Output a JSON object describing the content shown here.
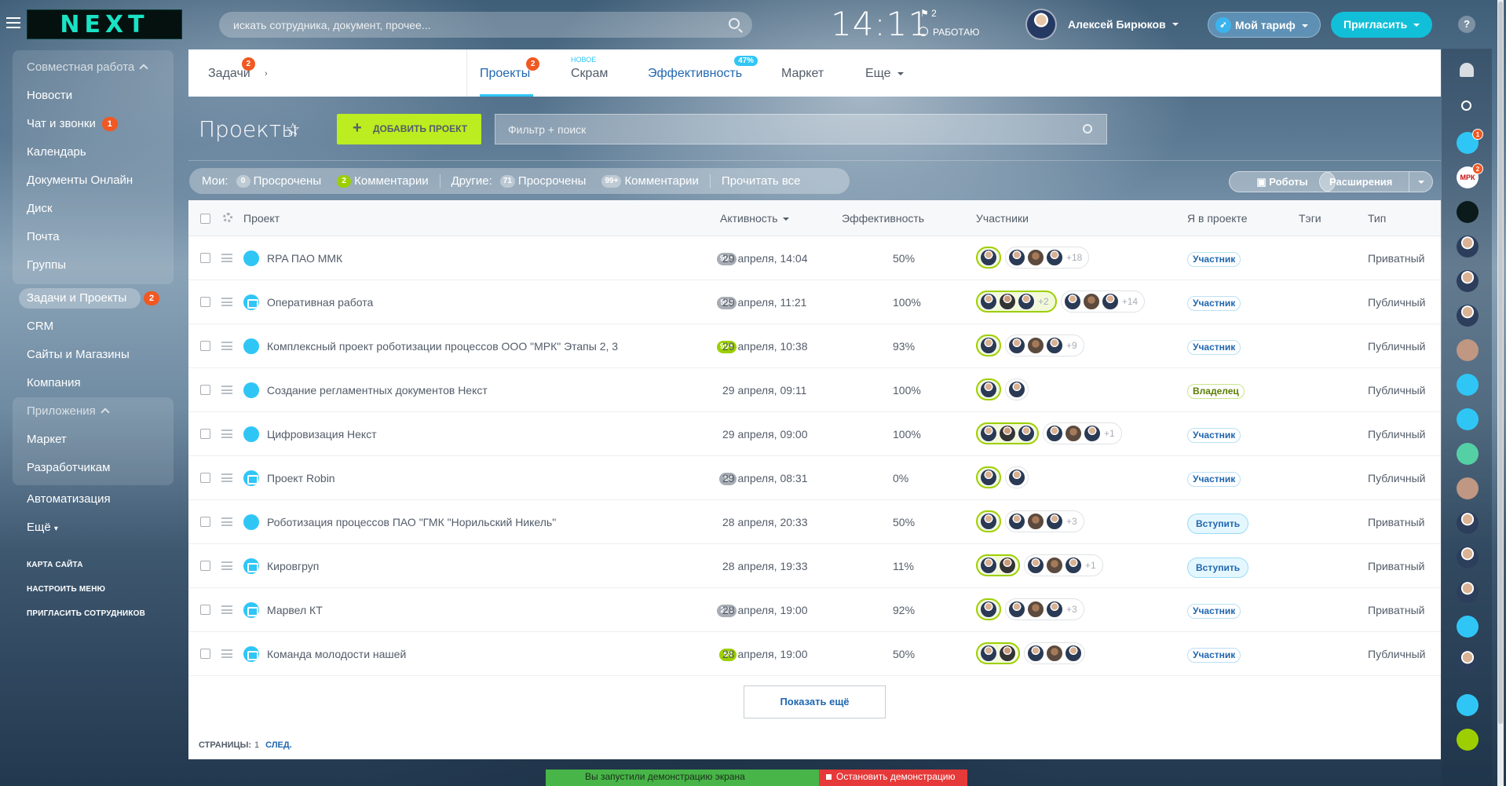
{
  "header": {
    "logo": "NEXT",
    "search_placeholder": "искать сотрудника, документ, прочее...",
    "clock": "14:11",
    "flag_count": "2",
    "work_status": "РАБОТАЮ",
    "user_name": "Алексей Бирюков",
    "tariff_label": "Мой тариф",
    "invite_label": "Пригласить",
    "help": "?"
  },
  "sidebar": {
    "group1_title": "Совместная работа",
    "group1_items": [
      "Новости",
      "Чат и звонки",
      "Календарь",
      "Документы Онлайн",
      "Диск",
      "Почта",
      "Группы"
    ],
    "chat_badge": "1",
    "active_item": "Задачи и Проекты",
    "active_badge": "2",
    "items2": [
      "CRM",
      "Сайты и Магазины",
      "Компания"
    ],
    "group2_title": "Приложения",
    "group2_items": [
      "Маркет",
      "Разработчикам"
    ],
    "items3": [
      "Автоматизация",
      "Ещё"
    ],
    "small_links": [
      "КАРТА САЙТА",
      "НАСТРОИТЬ МЕНЮ",
      "ПРИГЛАСИТЬ СОТРУДНИКОВ"
    ]
  },
  "tabs": {
    "tasks": "Задачи",
    "tasks_count": "2",
    "projects": "Проекты",
    "projects_count": "2",
    "scrum": "Скрам",
    "scrum_new": "НОВОЕ",
    "efficiency": "Эффективность",
    "efficiency_pct": "47%",
    "market": "Маркет",
    "more": "Еще"
  },
  "toolbar": {
    "title": "Проекты",
    "add_button": "Добавить проект",
    "filter_placeholder": "Фильтр + поиск",
    "robots": "Роботы",
    "extensions": "Расширения"
  },
  "counters": {
    "mine_label": "Мои:",
    "mine_overdue_count": "0",
    "mine_overdue": "Просрочены",
    "mine_comments_count": "2",
    "mine_comments": "Комментарии",
    "others_label": "Другие:",
    "others_overdue_count": "71",
    "others_overdue": "Просрочены",
    "others_comments_count": "99+",
    "others_comments": "Комментарии",
    "read_all": "Прочитать все"
  },
  "grid": {
    "columns": {
      "project": "Проект",
      "activity": "Активность",
      "efficiency": "Эффективность",
      "members": "Участники",
      "my_role": "Я в проекте",
      "tags": "Тэги",
      "type": "Тип"
    },
    "rows": [
      {
        "name": "RPA ПАО ММК",
        "icon": "mmk-logo-icon",
        "msgs": "99+",
        "msg_color": "grey",
        "date": "29 апреля, 14:04",
        "eff": "50%",
        "own": 1,
        "others": 3,
        "more": "+18",
        "role": "Участник",
        "role_kind": "member",
        "type": "Приватный"
      },
      {
        "name": "Оперативная работа",
        "icon": "folder-icon",
        "msgs": "980",
        "msg_color": "grey",
        "date": "29 апреля, 11:21",
        "eff": "100%",
        "own": 3,
        "own_more": "+2",
        "others": 3,
        "more": "+14",
        "role": "Участник",
        "role_kind": "member",
        "type": "Публичный"
      },
      {
        "name": "Комплексный проект роботизации процессов ООО \"МРК\" Этапы 2, 3",
        "icon": "mrk-logo-icon",
        "msgs": "99+",
        "msg_color": "green",
        "date": "29 апреля, 10:38",
        "eff": "93%",
        "own": 1,
        "others": 3,
        "more": "+9",
        "role": "Участник",
        "role_kind": "member",
        "type": "Публичный"
      },
      {
        "name": "Создание регламентных документов Некст",
        "icon": "group-icon",
        "msgs": "",
        "msg_color": "grey",
        "date": "29 апреля, 09:11",
        "eff": "100%",
        "own": 1,
        "others": 1,
        "more": "",
        "role": "Владелец",
        "role_kind": "owner",
        "type": "Публичный"
      },
      {
        "name": "Цифровизация Некст",
        "icon": "next-logo-icon",
        "msgs": "",
        "msg_color": "grey",
        "date": "29 апреля, 09:00",
        "eff": "100%",
        "own": 3,
        "others": 3,
        "more": "+1",
        "role": "Участник",
        "role_kind": "member",
        "type": "Публичный"
      },
      {
        "name": "Проект Robin",
        "icon": "folder-icon",
        "msgs": "14",
        "msg_color": "grey",
        "date": "29 апреля, 08:31",
        "eff": "0%",
        "own": 1,
        "others": 1,
        "more": "",
        "role": "Участник",
        "role_kind": "member",
        "type": "Публичный"
      },
      {
        "name": "Роботизация процессов ПАО \"ГМК \"Норильский Никель\"",
        "icon": "nornickel-logo-icon",
        "msgs": "",
        "msg_color": "grey",
        "date": "28 апреля, 20:33",
        "eff": "50%",
        "own": 1,
        "others": 3,
        "more": "+3",
        "role": "Вступить",
        "role_kind": "join",
        "type": "Приватный"
      },
      {
        "name": "Кировгруп",
        "icon": "folder-icon",
        "msgs": "",
        "msg_color": "grey",
        "date": "28 апреля, 19:33",
        "eff": "11%",
        "own": 2,
        "others": 3,
        "more": "+1",
        "role": "Вступить",
        "role_kind": "join",
        "type": "Приватный"
      },
      {
        "name": "Марвел КТ",
        "icon": "folder-icon",
        "msgs": "225",
        "msg_color": "grey",
        "date": "28 апреля, 19:00",
        "eff": "92%",
        "own": 1,
        "others": 3,
        "more": "+3",
        "role": "Участник",
        "role_kind": "member",
        "type": "Приватный"
      },
      {
        "name": "Команда молодости нашей",
        "icon": "folder-icon",
        "msgs": "59",
        "msg_color": "green",
        "date": "28 апреля, 19:00",
        "eff": "50%",
        "own": 2,
        "others": 3,
        "more": "",
        "role": "Участник",
        "role_kind": "member",
        "type": "Публичный"
      }
    ],
    "show_more": "Показать ещё",
    "pages_label": "СТРАНИЦЫ:",
    "page": "1",
    "next": "СЛЕД."
  },
  "rightbar": {
    "mrk_label": "МРК",
    "badge1": "1",
    "badge2": "2"
  },
  "demo": {
    "started": "Вы запустили демонстрацию экрана",
    "stop": "Остановить демонстрацию"
  },
  "colors": {
    "accent_blue": "#2fc6f6",
    "add_green": "#bbed21",
    "badge_orange": "#f15822",
    "link_blue": "#2067b0"
  }
}
